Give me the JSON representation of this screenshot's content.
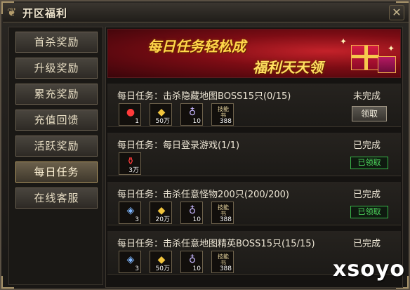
{
  "window": {
    "title": "开区福利",
    "close_glyph": "✕"
  },
  "sidebar": {
    "items": [
      {
        "label": "首杀奖励"
      },
      {
        "label": "升级奖励"
      },
      {
        "label": "累充奖励"
      },
      {
        "label": "充值回馈"
      },
      {
        "label": "活跃奖励"
      },
      {
        "label": "每日任务",
        "active": true
      },
      {
        "label": "在线客服"
      }
    ]
  },
  "banner": {
    "line1": "每日任务轻松成",
    "line2": "福利天天领"
  },
  "tasks": [
    {
      "text": "每日任务：击杀隐藏地图BOSS15只(0/15)",
      "status": "未完成",
      "action": "领取",
      "rewards": [
        {
          "icon": "red-orb-icon",
          "count": "1"
        },
        {
          "icon": "gold-ingot-icon",
          "count": "50万"
        },
        {
          "icon": "ring-icon",
          "count": "10"
        },
        {
          "icon": "scroll-icon",
          "label": "技能书",
          "count": "388"
        }
      ]
    },
    {
      "text": "每日任务：每日登录游戏(1/1)",
      "status": "已完成",
      "action": "已领取",
      "rewards": [
        {
          "icon": "potion-icon",
          "count": "3万"
        }
      ]
    },
    {
      "text": "每日任务：击杀任意怪物200只(200/200)",
      "status": "已完成",
      "action": "已领取",
      "rewards": [
        {
          "icon": "blue-gem-icon",
          "count": "3"
        },
        {
          "icon": "gold-ingot-icon",
          "count": "20万"
        },
        {
          "icon": "ring-icon",
          "count": "10"
        },
        {
          "icon": "scroll-icon",
          "label": "技能书",
          "count": "388"
        }
      ]
    },
    {
      "text": "每日任务：击杀任意地图精英BOSS15只(15/15)",
      "status": "已完成",
      "action": "",
      "rewards": [
        {
          "icon": "blue-gem-icon",
          "count": "3"
        },
        {
          "icon": "gold-ingot-icon",
          "count": "50万"
        },
        {
          "icon": "ring-icon",
          "count": "10"
        },
        {
          "icon": "scroll-icon",
          "label": "技能书",
          "count": "388"
        }
      ]
    }
  ],
  "watermark": "xsoyo",
  "colors": {
    "accent_red": "#7c0c14",
    "gold_text": "#ffd64a",
    "claimed_green": "#4fdc5e"
  }
}
